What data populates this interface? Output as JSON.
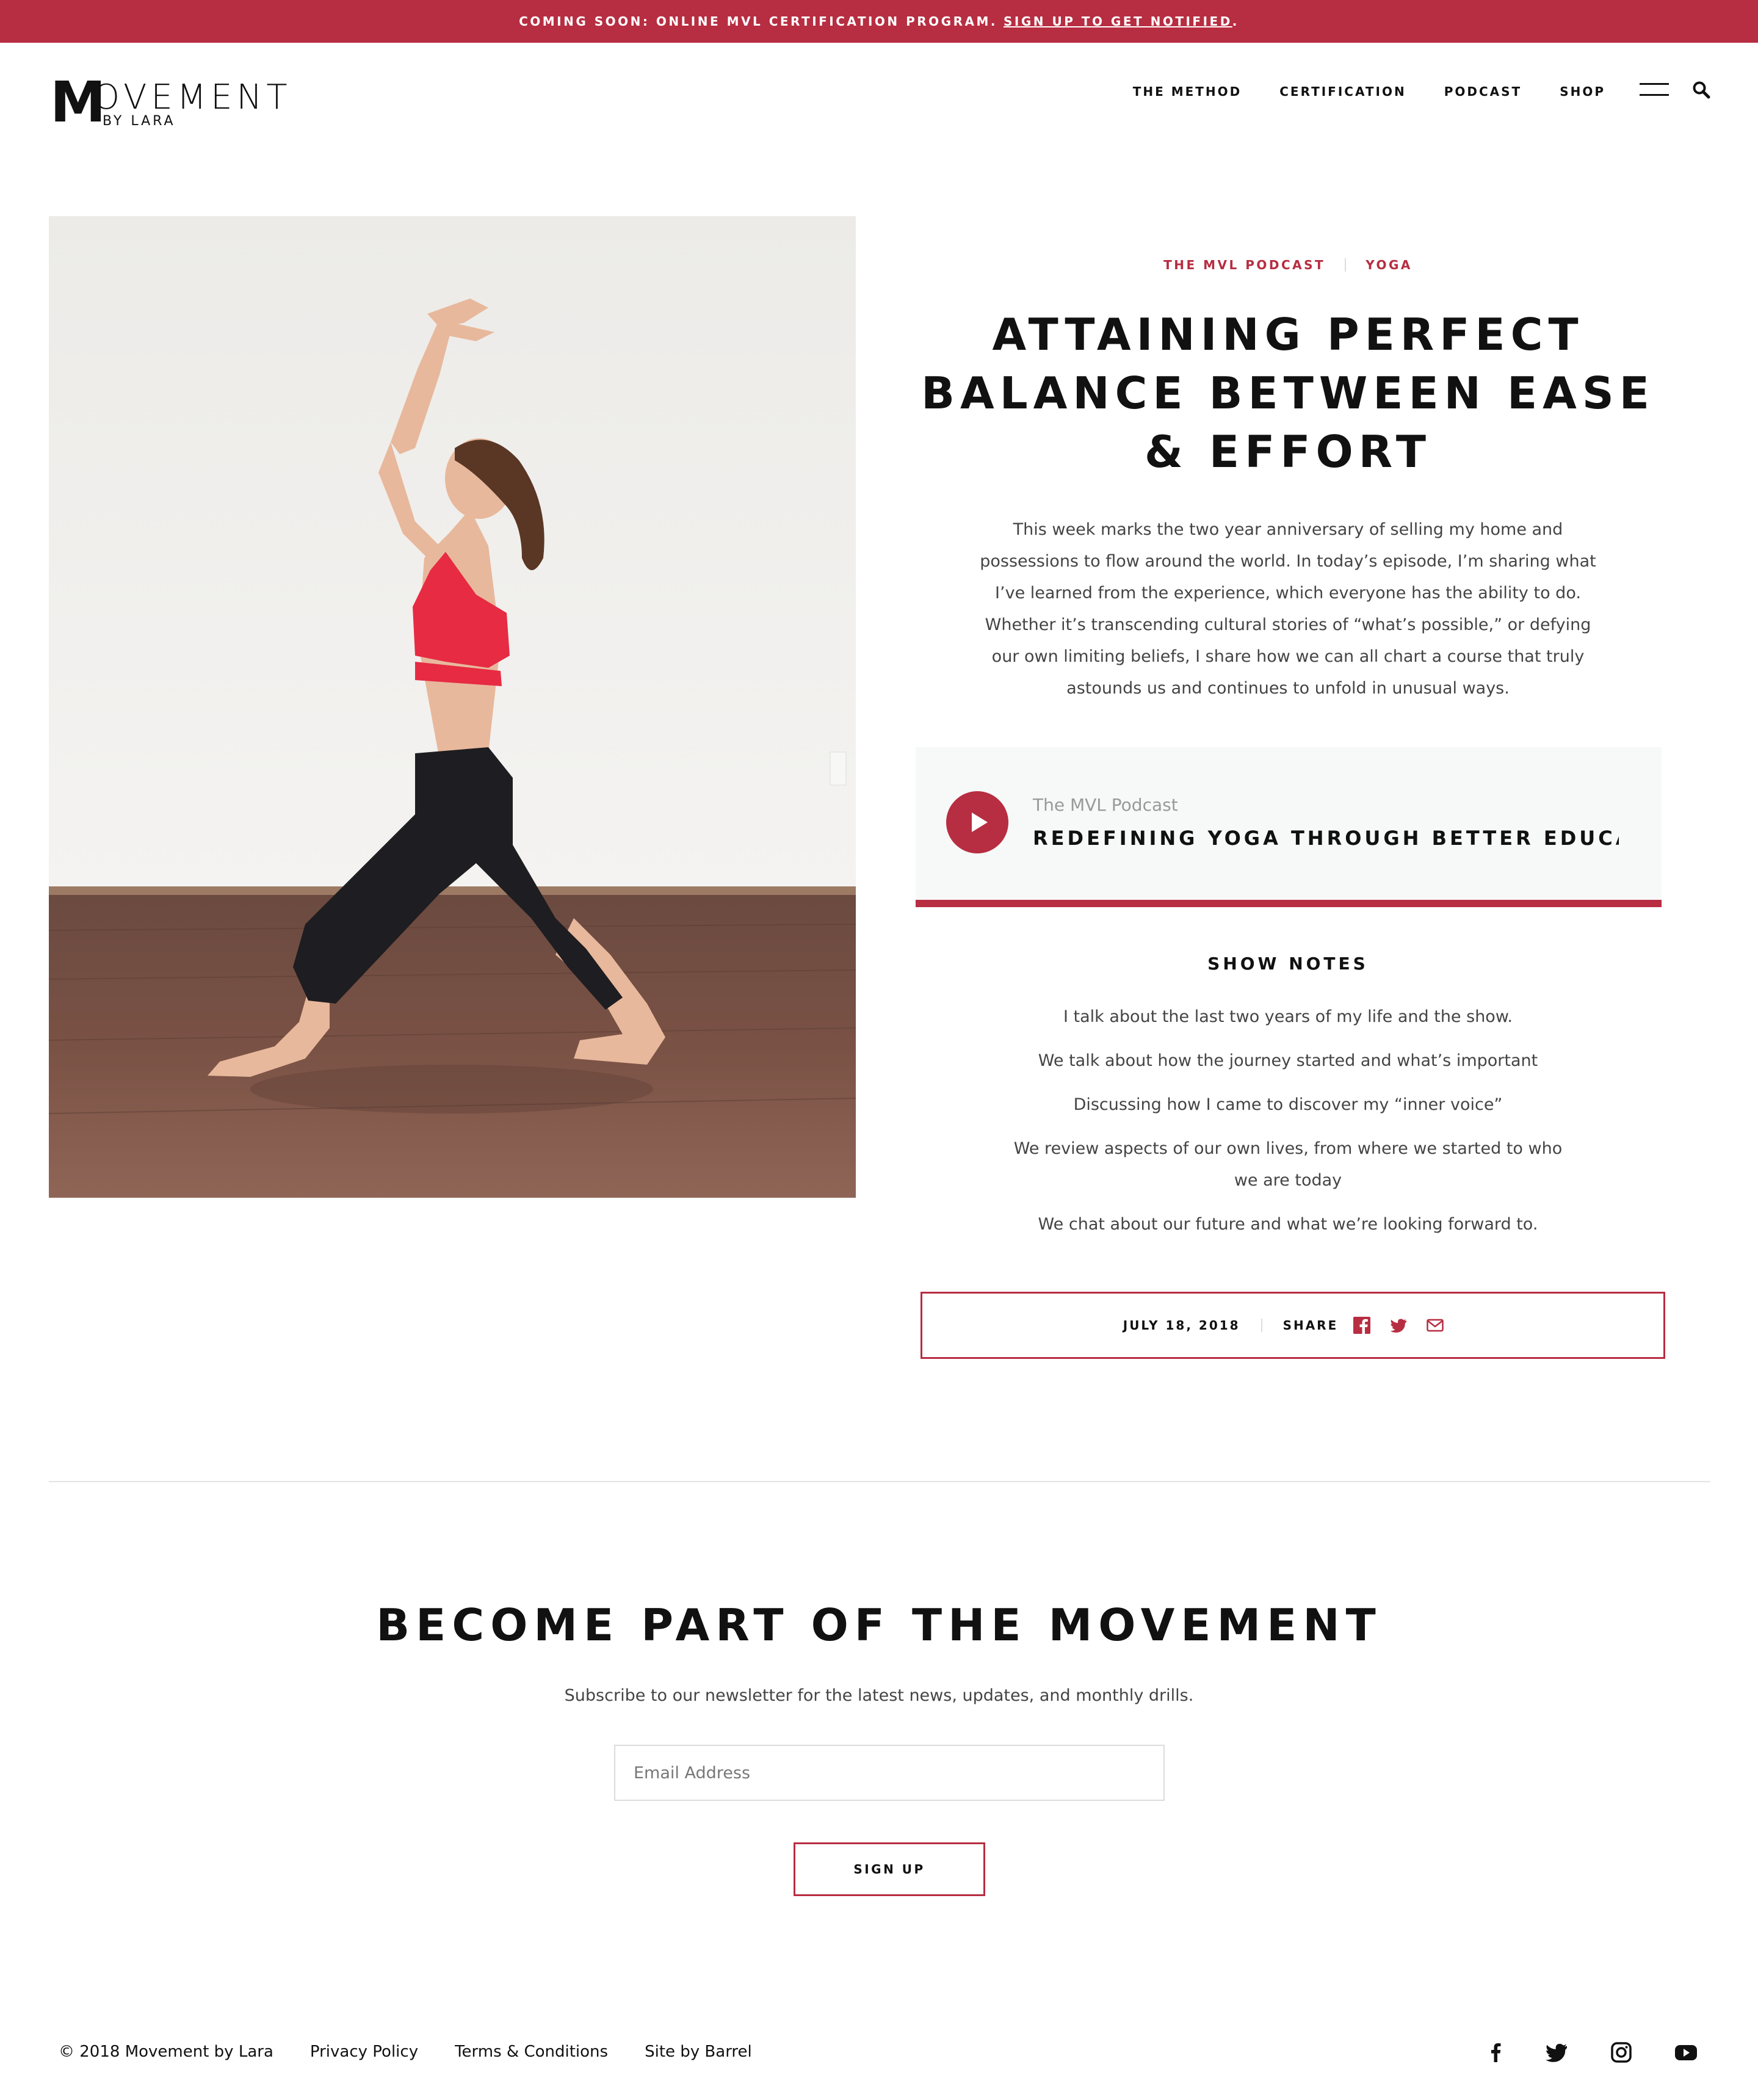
{
  "announcement": {
    "text": "COMING SOON: ONLINE MVL CERTIFICATION PROGRAM.",
    "link": "SIGN UP TO GET NOTIFIED",
    "suffix": "."
  },
  "header": {
    "logo": {
      "initial": "M",
      "rest": "OVEMENT",
      "by": "BY LARA"
    },
    "nav": [
      "THE METHOD",
      "CERTIFICATION",
      "PODCAST",
      "SHOP"
    ]
  },
  "article": {
    "categories": [
      "THE MVL PODCAST",
      "YOGA"
    ],
    "title": "ATTAINING PERFECT BALANCE BETWEEN EASE & EFFORT",
    "intro": "This week marks the two year anniversary of selling my home and possessions to flow around the world. In today’s episode, I’m sharing what I’ve learned from the experience, which everyone has the ability to do. Whether it’s transcending cultural stories of “what’s possible,” or defying our own limiting beliefs, I share how we can all chart a course that truly astounds us and continues to unfold in unusual ways.",
    "player": {
      "show": "The MVL Podcast",
      "episode": "REDEFINING YOGA THROUGH BETTER EDUCATION"
    },
    "show_notes_heading": "SHOW NOTES",
    "show_notes": [
      "I talk about the last two years of my life and the show.",
      "We talk about how the journey started and what’s important",
      "Discussing how I came to discover my “inner voice”",
      "We review aspects of our own lives, from where we started to who we are today",
      "We chat about our future and what we’re looking forward to."
    ],
    "date": "JULY 18, 2018",
    "share_label": "SHARE"
  },
  "newsletter": {
    "title": "BECOME PART OF THE MOVEMENT",
    "subtitle": "Subscribe to our newsletter for the latest news, updates, and monthly drills.",
    "email_placeholder": "Email Address",
    "button": "SIGN UP"
  },
  "footer": {
    "copyright": "© 2018 Movement by Lara",
    "links": [
      "Privacy Policy",
      "Terms & Conditions",
      "Site by Barrel"
    ],
    "social_icons": [
      "facebook-icon",
      "twitter-icon",
      "instagram-icon",
      "youtube-icon"
    ]
  },
  "colors": {
    "accent": "#b72d41",
    "panel": "#f7f8f8",
    "text": "#111111",
    "body_text": "#444444"
  },
  "icons": {
    "menu": "hamburger-icon",
    "search": "search-icon",
    "play": "play-icon"
  }
}
